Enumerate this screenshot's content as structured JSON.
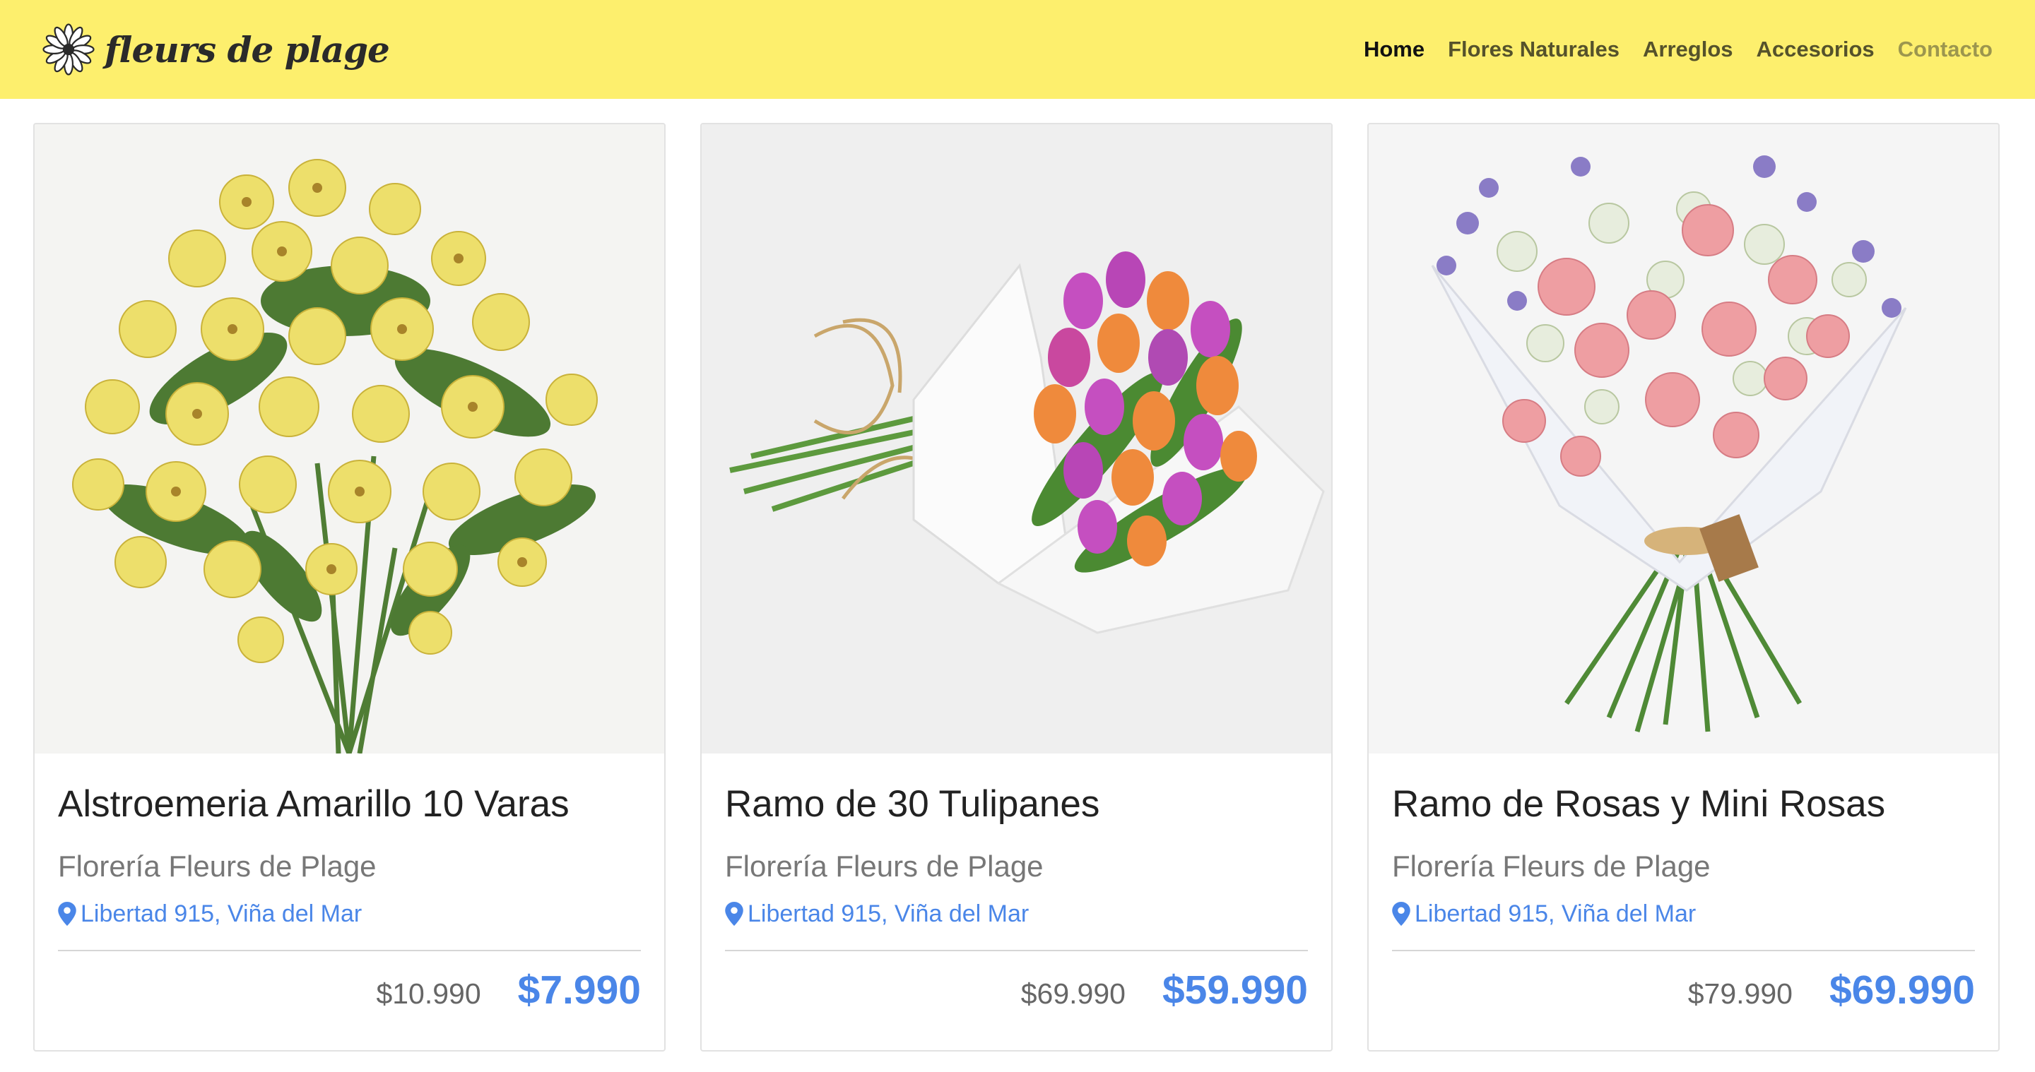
{
  "header": {
    "brand": "fleurs de plage",
    "nav": [
      {
        "label": "Home",
        "state": "active"
      },
      {
        "label": "Flores Naturales",
        "state": "normal"
      },
      {
        "label": "Arreglos",
        "state": "normal"
      },
      {
        "label": "Accesorios",
        "state": "normal"
      },
      {
        "label": "Contacto",
        "state": "muted"
      }
    ],
    "icon": "daisy-logo-icon"
  },
  "colors": {
    "navbar_bg": "#fdef6d",
    "accent_blue": "#4a86e8",
    "old_price": "#666666"
  },
  "products": [
    {
      "title": "Alstroemeria Amarillo 10 Varas",
      "shop": "Florería Fleurs de Plage",
      "location": "Libertad 915, Viña del Mar",
      "old_price": "$10.990",
      "price": "$7.990",
      "image": "yellow-alstroemeria-bouquet"
    },
    {
      "title": "Ramo de 30 Tulipanes",
      "shop": "Florería Fleurs de Plage",
      "location": "Libertad 915, Viña del Mar",
      "old_price": "$69.990",
      "price": "$59.990",
      "image": "tulip-bouquet-wrapped"
    },
    {
      "title": "Ramo de Rosas y Mini Rosas",
      "shop": "Florería Fleurs de Plage",
      "location": "Libertad 915, Viña del Mar",
      "old_price": "$79.990",
      "price": "$69.990",
      "image": "pink-white-rose-bouquet"
    }
  ]
}
